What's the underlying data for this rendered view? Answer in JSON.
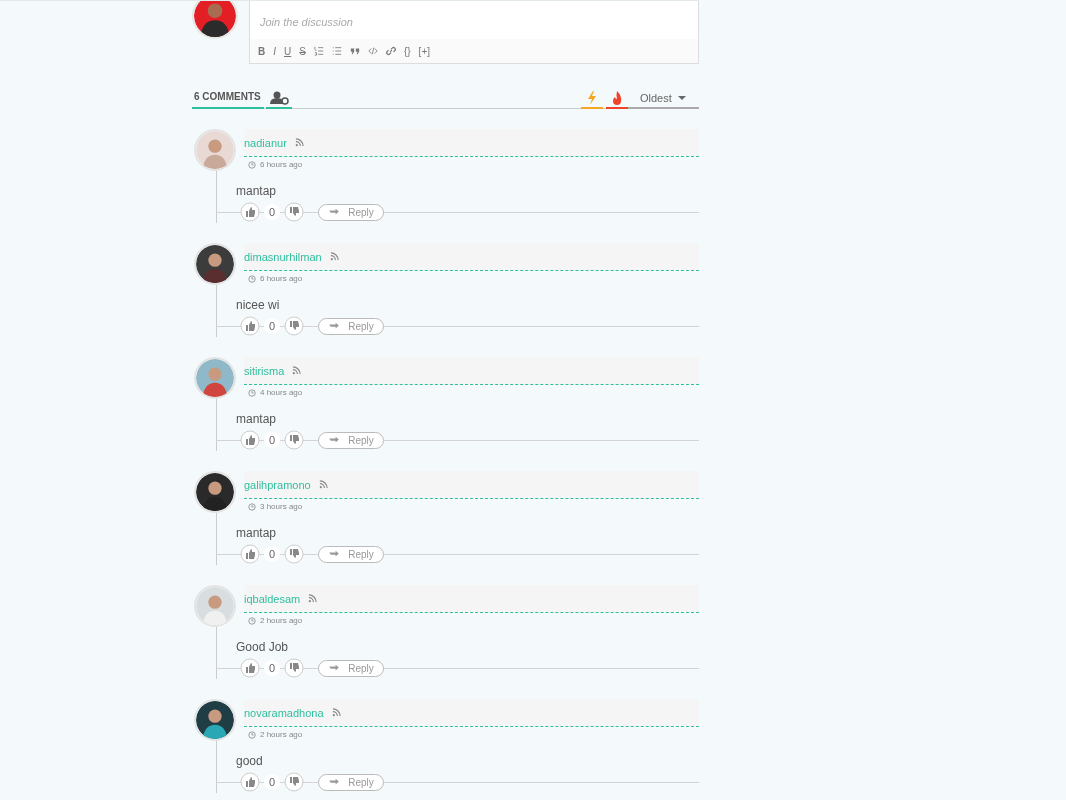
{
  "editor": {
    "placeholder": "Join the discussion",
    "toolbar": [
      {
        "kind": "bold",
        "label": "B"
      },
      {
        "kind": "italic",
        "label": "I"
      },
      {
        "kind": "underline",
        "label": "U"
      },
      {
        "kind": "strike",
        "label": "S"
      },
      {
        "kind": "ordered-list"
      },
      {
        "kind": "bullet-list"
      },
      {
        "kind": "quote"
      },
      {
        "kind": "code"
      },
      {
        "kind": "link"
      },
      {
        "kind": "text",
        "label": "{}"
      },
      {
        "kind": "text",
        "label": "[+]"
      }
    ]
  },
  "tabs": {
    "count_label": "6 COMMENTS",
    "sort": "Oldest"
  },
  "comments": [
    {
      "author": "nadianur",
      "time": "6 hours ago",
      "text": "mantap",
      "votes": "0",
      "reply": "Reply"
    },
    {
      "author": "dimasnurhilman",
      "time": "6 hours ago",
      "text": "nicee wi",
      "votes": "0",
      "reply": "Reply"
    },
    {
      "author": "sitirisma",
      "time": "4 hours ago",
      "text": "mantap",
      "votes": "0",
      "reply": "Reply"
    },
    {
      "author": "galihpramono",
      "time": "3 hours ago",
      "text": "mantap",
      "votes": "0",
      "reply": "Reply"
    },
    {
      "author": "iqbaldesam",
      "time": "2 hours ago",
      "text": "Good Job",
      "votes": "0",
      "reply": "Reply"
    },
    {
      "author": "novaramadhona",
      "time": "2 hours ago",
      "text": "good",
      "votes": "0",
      "reply": "Reply"
    }
  ]
}
